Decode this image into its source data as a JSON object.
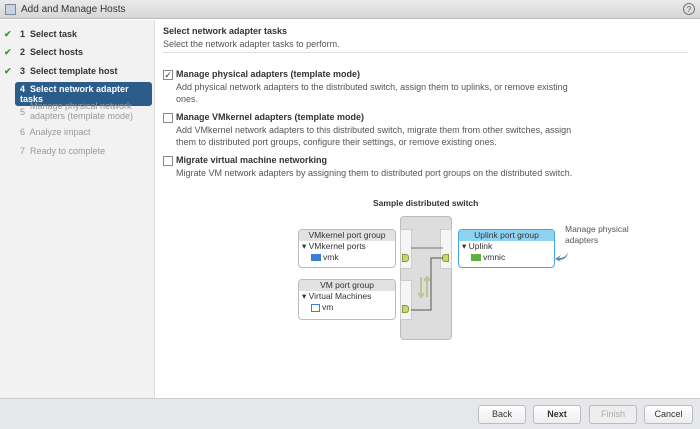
{
  "window": {
    "title": "Add and Manage Hosts",
    "help": "?"
  },
  "steps": [
    {
      "num": "1",
      "label": "Select task",
      "state": "done"
    },
    {
      "num": "2",
      "label": "Select hosts",
      "state": "done"
    },
    {
      "num": "3",
      "label": "Select template host",
      "state": "done"
    },
    {
      "num": "4",
      "label": "Select network adapter tasks",
      "state": "active"
    },
    {
      "num": "5",
      "label": "Manage physical network adapters (template mode)",
      "state": "pending"
    },
    {
      "num": "6",
      "label": "Analyze impact",
      "state": "pending"
    },
    {
      "num": "7",
      "label": "Ready to complete",
      "state": "pending"
    }
  ],
  "main": {
    "title": "Select network adapter tasks",
    "subtitle": "Select the network adapter tasks to perform.",
    "options": [
      {
        "label": "Manage physical adapters (template mode)",
        "desc": "Add physical network adapters to the distributed switch, assign them to uplinks, or remove existing ones.",
        "checked": true
      },
      {
        "label": "Manage VMkernel adapters (template mode)",
        "desc": "Add VMkernel network adapters to this distributed switch, migrate them from other switches, assign them to distributed port groups, configure their settings, or remove existing ones.",
        "checked": false
      },
      {
        "label": "Migrate virtual machine networking",
        "desc": "Migrate VM network adapters by assigning them to distributed port groups on the distributed switch.",
        "checked": false
      }
    ]
  },
  "diagram": {
    "title": "Sample distributed switch",
    "vmk_group": {
      "header": "VMkernel port group",
      "section": "VMkernel ports",
      "item": "vmk"
    },
    "vm_group": {
      "header": "VM port group",
      "section": "Virtual Machines",
      "item": "vm"
    },
    "uplink_group": {
      "header": "Uplink port group",
      "section": "Uplink",
      "item": "vmnic"
    },
    "callout": "Manage physical adapters"
  },
  "footer": {
    "back": "Back",
    "next": "Next",
    "finish": "Finish",
    "cancel": "Cancel"
  }
}
